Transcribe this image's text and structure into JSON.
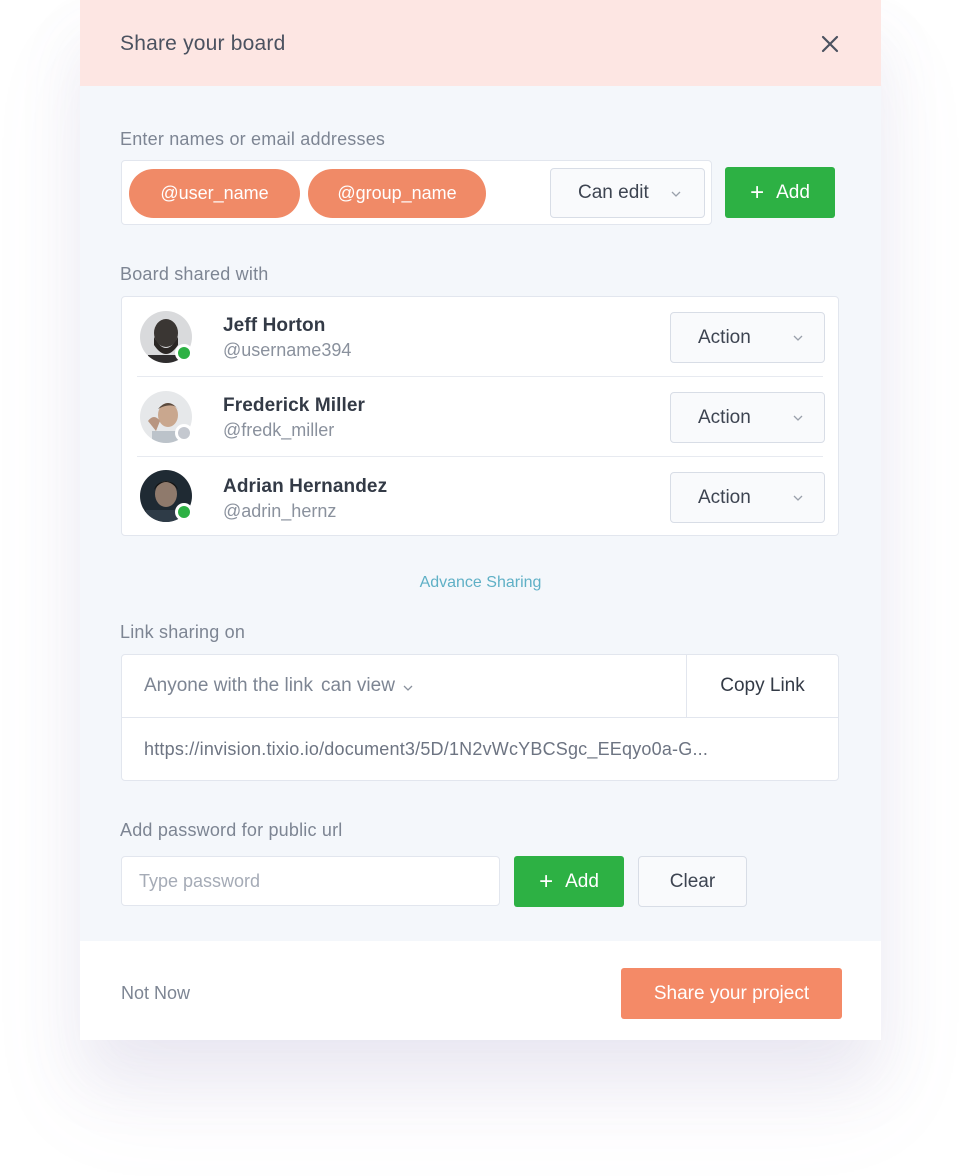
{
  "header": {
    "title": "Share your board",
    "close_icon": "close-icon"
  },
  "invite": {
    "label": "Enter names or email addresses",
    "chips": [
      "@user_name",
      "@group_name"
    ],
    "permission_value": "Can edit",
    "add_label": "Add",
    "accent_color": "#f08a67",
    "add_color": "#2db144"
  },
  "shared": {
    "label": "Board shared with",
    "members": [
      {
        "name": "Jeff Horton",
        "handle": "@username394",
        "status": "online",
        "action_label": "Action"
      },
      {
        "name": "Frederick Miller",
        "handle": "@fredk_miller",
        "status": "offline",
        "action_label": "Action"
      },
      {
        "name": "Adrian Hernandez",
        "handle": "@adrin_hernz",
        "status": "online",
        "action_label": "Action"
      }
    ],
    "status_colors": {
      "online": "#2db144",
      "offline": "#c4c8cf"
    }
  },
  "advance_link": "Advance Sharing",
  "link_sharing": {
    "label": "Link sharing on",
    "scope_text": "Anyone with the link",
    "permission": "can view",
    "copy_label": "Copy Link",
    "url": "https://invision.tixio.io/document3/5D/1N2vWcYBCSgc_EEqyo0a-G..."
  },
  "password": {
    "label": "Add password for public url",
    "placeholder": "Type password",
    "value": "",
    "add_label": "Add",
    "clear_label": "Clear"
  },
  "footer": {
    "not_now_label": "Not Now",
    "share_label": "Share your project",
    "share_color": "#f48a67"
  }
}
